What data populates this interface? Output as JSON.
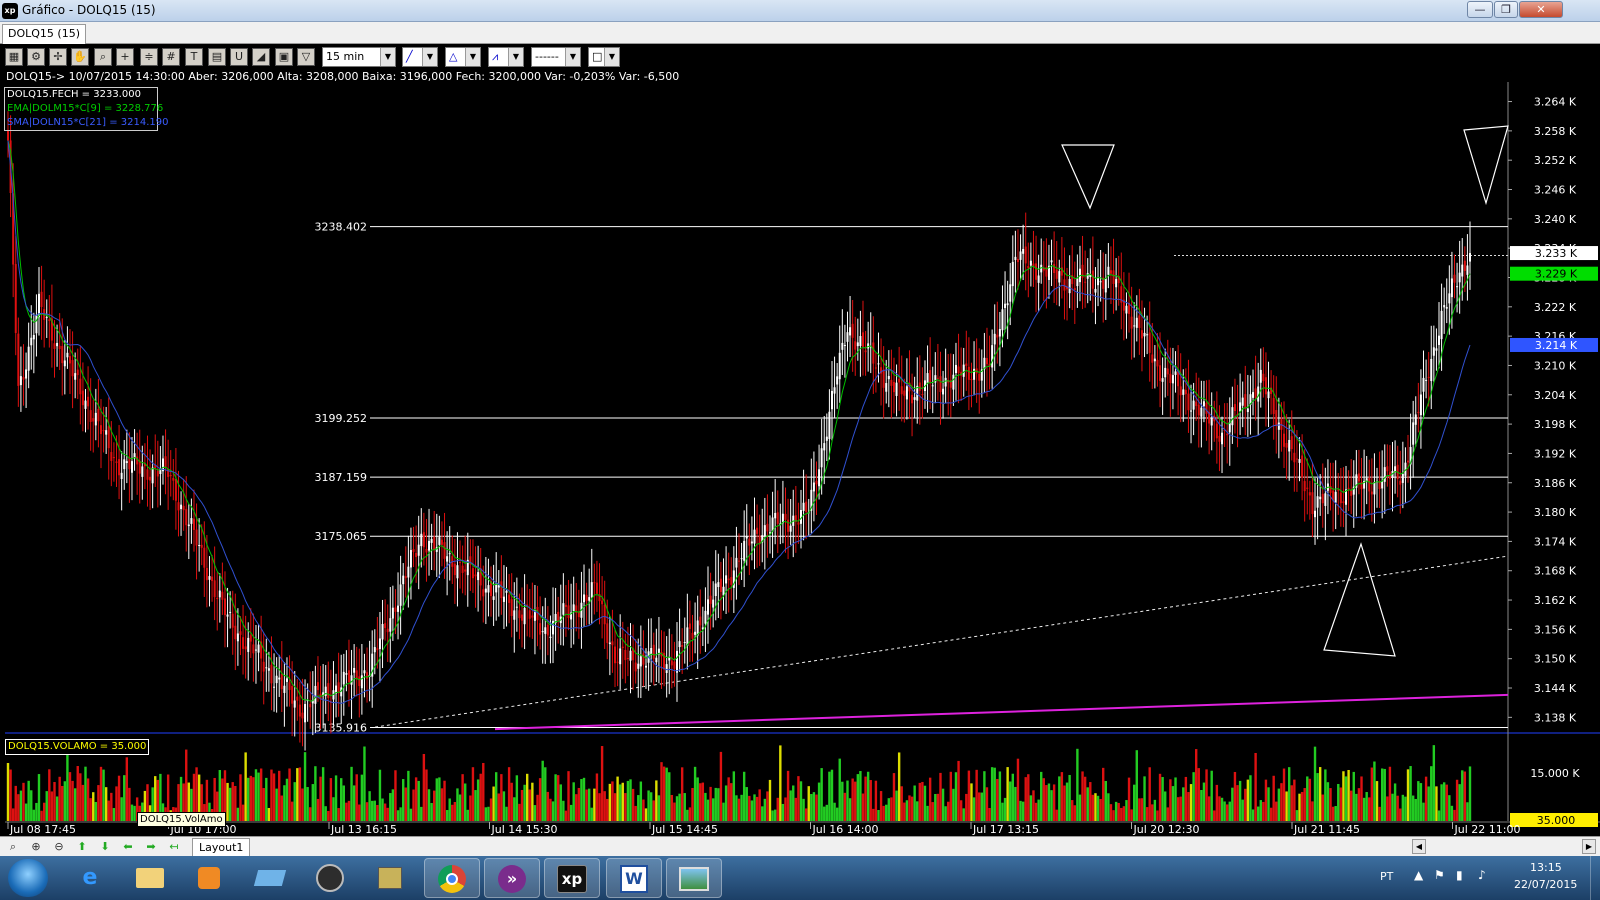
{
  "window": {
    "app_icon": "xp",
    "title": "Gráfico - DOLQ15 (15)",
    "minimize": "—",
    "maximize": "❐",
    "close": "✕"
  },
  "tab": {
    "label": "DOLQ15 (15)"
  },
  "toolbar": {
    "timeframe": "15 min",
    "line_style": "------",
    "icons": [
      "chart-type-icon",
      "settings-icon",
      "crosshair-icon",
      "hand-icon",
      "zoom-tool-icon",
      "cross-icon",
      "fibonacci-icon",
      "grid-icon",
      "text-icon",
      "calculator-icon",
      "magnet-icon",
      "eraser-icon",
      "clipboard-icon",
      "filter-icon"
    ]
  },
  "info_line": "DOLQ15-> 10/07/2015 14:30:00 Aber: 3206,000 Alta: 3208,000 Baixa: 3196,000 Fech: 3200,000 Var: -0,203% Var: -6,500",
  "legend": {
    "close": "DOLQ15.FECH = 3233.000",
    "ema": "EMA|DOLM15*C[9] = 3228.776",
    "sma": "SMA|DOLN15*C[21] = 3214.190"
  },
  "volume": {
    "label": "DOLQ15.VOLAMO = 35.000",
    "tooltip": "DOLQ15.VolAmo",
    "axis_label": "15.000 K",
    "current_tag": "35.000"
  },
  "price_axis": {
    "ticks": [
      "3.264 K",
      "3.258 K",
      "3.252 K",
      "3.246 K",
      "3.240 K",
      "3.234 K",
      "3.228 K",
      "3.222 K",
      "3.216 K",
      "3.210 K",
      "3.204 K",
      "3.198 K",
      "3.192 K",
      "3.186 K",
      "3.180 K",
      "3.174 K",
      "3.168 K",
      "3.162 K",
      "3.156 K",
      "3.150 K",
      "3.144 K",
      "3.138 K"
    ],
    "close_tag": "3.233 K",
    "ema_tag": "3.229 K",
    "sma_tag": "3.214 K"
  },
  "time_axis": [
    "Jul 08 17:45",
    "Jul 10 17:00",
    "Jul 13 16:15",
    "Jul 14 15:30",
    "Jul 15 14:45",
    "Jul 16 14:00",
    "Jul 17 13:15",
    "Jul 20 12:30",
    "Jul 21 11:45",
    "Jul 22 11:00"
  ],
  "levels": [
    "3238.402",
    "3199.252",
    "3187.159",
    "3175.065",
    "3135.916"
  ],
  "colors": {
    "background": "#000000",
    "up_candle": "#ffffff",
    "down_candle": "#e01010",
    "ema": "#00c000",
    "sma": "#3050d0",
    "vol_up": "#22cc22",
    "vol_down": "#dd1111",
    "vol_neutral": "#dddd00",
    "channel": "#dd22dd",
    "level_line": "#ffffff"
  },
  "chart_data": {
    "type": "candlestick",
    "ylim": [
      3135,
      3268
    ],
    "anchors_close": [
      [
        0,
        3255
      ],
      [
        4,
        3205
      ],
      [
        12,
        3222
      ],
      [
        28,
        3205
      ],
      [
        42,
        3190
      ],
      [
        62,
        3188
      ],
      [
        85,
        3158
      ],
      [
        113,
        3140
      ],
      [
        140,
        3148
      ],
      [
        160,
        3175
      ],
      [
        185,
        3165
      ],
      [
        208,
        3156
      ],
      [
        228,
        3164
      ],
      [
        235,
        3150
      ],
      [
        258,
        3150
      ],
      [
        290,
        3176
      ],
      [
        310,
        3180
      ],
      [
        325,
        3218
      ],
      [
        345,
        3204
      ],
      [
        380,
        3210
      ],
      [
        390,
        3232
      ],
      [
        412,
        3227
      ],
      [
        427,
        3228
      ],
      [
        435,
        3220
      ],
      [
        445,
        3210
      ],
      [
        470,
        3196
      ],
      [
        485,
        3207
      ],
      [
        505,
        3182
      ],
      [
        522,
        3185
      ],
      [
        540,
        3188
      ],
      [
        555,
        3220
      ],
      [
        566,
        3234
      ]
    ],
    "levels": [
      3238.402,
      3199.252,
      3187.159,
      3175.065,
      3135.916
    ],
    "last_close": 3233,
    "ema_last": 3228.776,
    "sma_last": 3214.19
  },
  "bottom_bar": {
    "layout_tab": "Layout1",
    "icons": [
      "zoom-fit-icon",
      "zoom-in-icon",
      "zoom-out-icon",
      "arrow-up-icon",
      "arrow-down-icon",
      "arrow-left-icon",
      "arrow-right-icon",
      "arrow-first-icon"
    ]
  },
  "taskbar": {
    "apps": [
      "ie-icon",
      "explorer-icon",
      "media-icon",
      "network-icon",
      "hp-icon",
      "files-icon",
      "chrome-icon",
      "broker-icon",
      "xp-icon",
      "word-icon",
      "photo-icon"
    ],
    "xp_label": "xp",
    "word_label": "W",
    "language": "PT",
    "time": "13:15",
    "date": "22/07/2015"
  }
}
